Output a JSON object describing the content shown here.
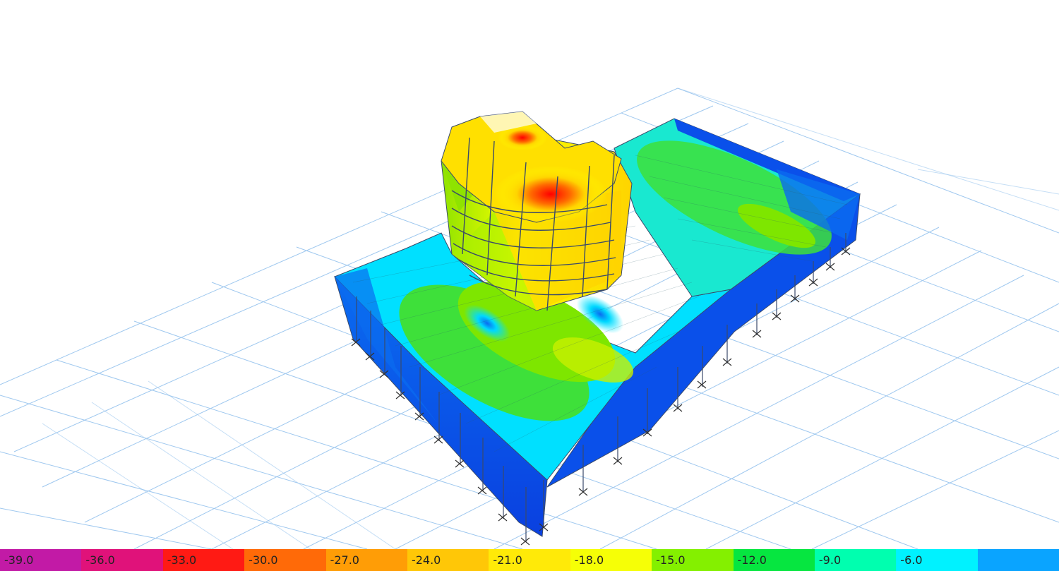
{
  "legend": {
    "labels": [
      "-39.0",
      "-36.0",
      "-33.0",
      "-30.0",
      "-27.0",
      "-24.0",
      "-21.0",
      "-18.0",
      "-15.0",
      "-12.0",
      "-9.0",
      "-6.0",
      ""
    ],
    "colors": [
      "#c21aa6",
      "#e0127a",
      "#ff1a14",
      "#ff6a08",
      "#ff9d06",
      "#ffc707",
      "#ffea08",
      "#f6ff06",
      "#84f000",
      "#06e640",
      "#00ffaf",
      "#00f2ff",
      "#0aa4ff"
    ]
  },
  "colors": {
    "grid": "#9fc8ef",
    "structure_edge": "#3a4a6a",
    "low_stress": "#0a4fe8",
    "mid_low": "#00e6ff",
    "mid": "#3ee03a",
    "mid_high": "#ffff00",
    "high": "#ff7a00",
    "peak": "#ff0000"
  }
}
